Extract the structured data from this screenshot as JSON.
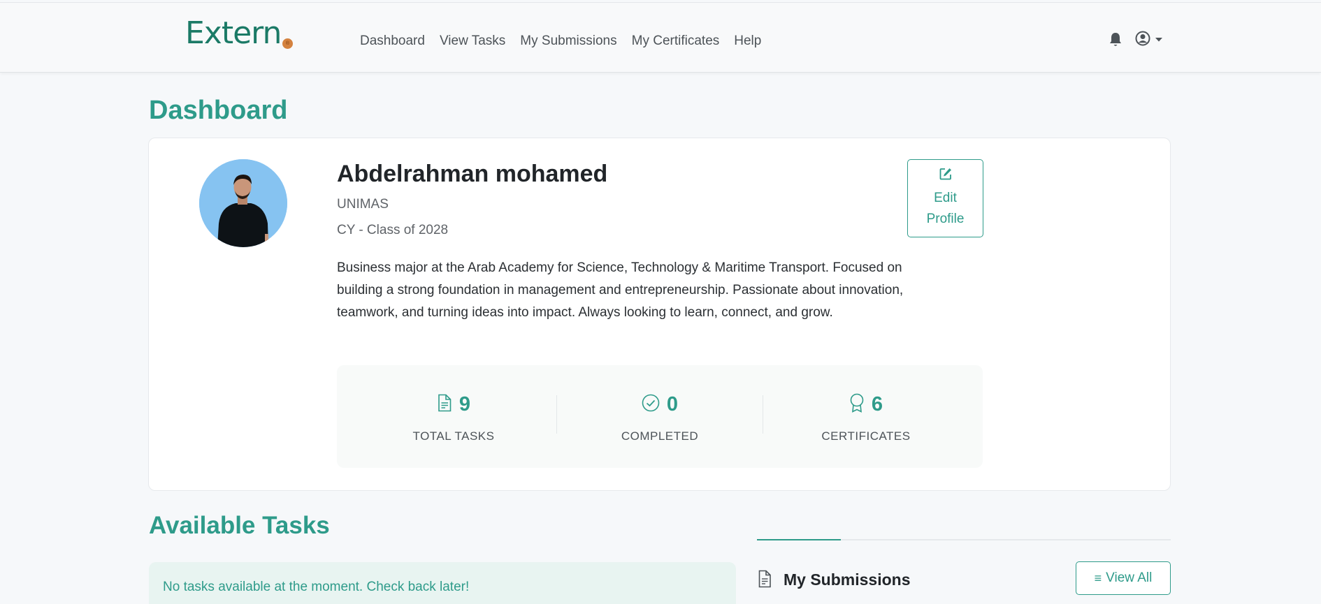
{
  "brand": {
    "name": "Extern",
    "badge": "®"
  },
  "nav": {
    "links": [
      {
        "label": "Dashboard"
      },
      {
        "label": "View Tasks"
      },
      {
        "label": "My Submissions"
      },
      {
        "label": "My Certificates"
      },
      {
        "label": "Help"
      }
    ],
    "icons": [
      "bell-icon",
      "user-circle-icon",
      "caret-down-icon"
    ]
  },
  "page": {
    "title": "Dashboard"
  },
  "profile": {
    "name": "Abdelrahman mohamed",
    "institution": "UNIMAS",
    "class_line": "CY - Class of 2028",
    "bio": "Business major at the Arab Academy for Science, Technology & Maritime Transport. Focused on building a strong foundation in management and entrepreneurship. Passionate about innovation, teamwork, and turning ideas into impact. Always looking to learn, connect, and grow.",
    "edit_label": "Edit Profile"
  },
  "stats": [
    {
      "icon": "document-icon",
      "value": "9",
      "label": "TOTAL TASKS"
    },
    {
      "icon": "check-circle-icon",
      "value": "0",
      "label": "COMPLETED"
    },
    {
      "icon": "award-icon",
      "value": "6",
      "label": "CERTIFICATES"
    }
  ],
  "tasks": {
    "title": "Available Tasks",
    "empty_message": "No tasks available at the moment. Check back later!"
  },
  "submissions": {
    "title": "My Submissions",
    "view_all_label": "View All"
  },
  "colors": {
    "accent": "#2e9b8a",
    "brand": "#1b7a66",
    "brand_dot": "#d4823f",
    "avatar_bg": "#86c3f1"
  }
}
